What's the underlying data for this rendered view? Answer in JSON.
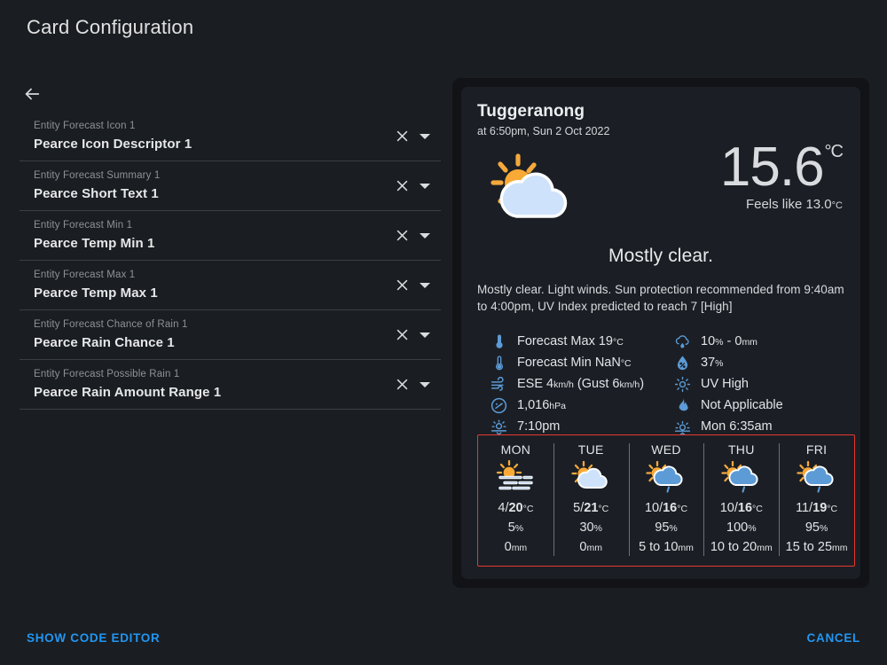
{
  "dialog": {
    "title": "Card Configuration"
  },
  "config": {
    "back_icon": "arrow-left-icon",
    "clear_icon": "close-icon",
    "dropdown_icon": "chevron-down-icon",
    "fields": [
      {
        "label": "Entity Forecast Icon 1",
        "value": "Pearce Icon Descriptor 1"
      },
      {
        "label": "Entity Forecast Summary 1",
        "value": "Pearce Short Text 1"
      },
      {
        "label": "Entity Forecast Min 1",
        "value": "Pearce Temp Min 1"
      },
      {
        "label": "Entity Forecast Max 1",
        "value": "Pearce Temp Max 1"
      },
      {
        "label": "Entity Forecast Chance of Rain 1",
        "value": "Pearce Rain Chance 1"
      },
      {
        "label": "Entity Forecast Possible Rain 1",
        "value": "Pearce Rain Amount Range 1"
      }
    ]
  },
  "preview": {
    "location": "Tuggeranong",
    "observed_at": "at 6:50pm, Sun 2 Oct 2022",
    "current_icon": "sun-behind-cloud-icon",
    "temperature": "15.6",
    "temperature_unit": "°C",
    "feels_like": "Feels like 13.0",
    "feels_like_unit": "°C",
    "summary_heading": "Mostly clear.",
    "summary_text": "Mostly clear. Light winds. Sun protection recommended from 9:40am to 4:00pm, UV Index predicted to reach 7 [High]",
    "details_left": [
      {
        "icon": "thermometer-high-icon",
        "text": "Forecast Max 19",
        "unit": "°C"
      },
      {
        "icon": "thermometer-low-icon",
        "text": "Forecast Min NaN",
        "unit": "°C"
      },
      {
        "icon": "wind-icon",
        "text": "ESE 4",
        "unit": "km/h",
        "text2": " (Gust 6",
        "unit2": "km/h",
        "text3": ")"
      },
      {
        "icon": "gauge-icon",
        "text": "1,016",
        "unit": "hPa"
      },
      {
        "icon": "sunset-icon",
        "text": "7:10pm",
        "unit": ""
      }
    ],
    "details_right": [
      {
        "icon": "rain-cloud-icon",
        "text": "10",
        "unit": "%",
        "text2": " - 0",
        "unit2": "mm"
      },
      {
        "icon": "humidity-icon",
        "text": "37",
        "unit": "%"
      },
      {
        "icon": "uv-index-icon",
        "text": "UV High",
        "unit": ""
      },
      {
        "icon": "fire-danger-icon",
        "text": "Not Applicable",
        "unit": ""
      },
      {
        "icon": "sunrise-icon",
        "text": "Mon 6:35am",
        "unit": ""
      }
    ],
    "highlight_color": "#e8372e",
    "forecast": [
      {
        "day": "MON",
        "icon": "sun-haze-icon",
        "min": "4",
        "max": "20",
        "unit": "°C",
        "pop": "5",
        "pop_unit": "%",
        "amount": "0",
        "amount_unit": "mm"
      },
      {
        "day": "TUE",
        "icon": "sun-behind-cloud-icon",
        "min": "5",
        "max": "21",
        "unit": "°C",
        "pop": "30",
        "pop_unit": "%",
        "amount": "0",
        "amount_unit": "mm"
      },
      {
        "day": "WED",
        "icon": "sun-behind-rain-icon",
        "min": "10",
        "max": "16",
        "unit": "°C",
        "pop": "95",
        "pop_unit": "%",
        "amount": "5 to 10",
        "amount_unit": "mm"
      },
      {
        "day": "THU",
        "icon": "sun-behind-rain-icon",
        "min": "10",
        "max": "16",
        "unit": "°C",
        "pop": "100",
        "pop_unit": "%",
        "amount": "10 to 20",
        "amount_unit": "mm"
      },
      {
        "day": "FRI",
        "icon": "sun-behind-rain-icon",
        "min": "11",
        "max": "19",
        "unit": "°C",
        "pop": "95",
        "pop_unit": "%",
        "amount": "15 to 25",
        "amount_unit": "mm"
      }
    ]
  },
  "actions": {
    "show_code_editor": "SHOW CODE EDITOR",
    "cancel": "CANCEL",
    "link_color": "#2196f3"
  }
}
